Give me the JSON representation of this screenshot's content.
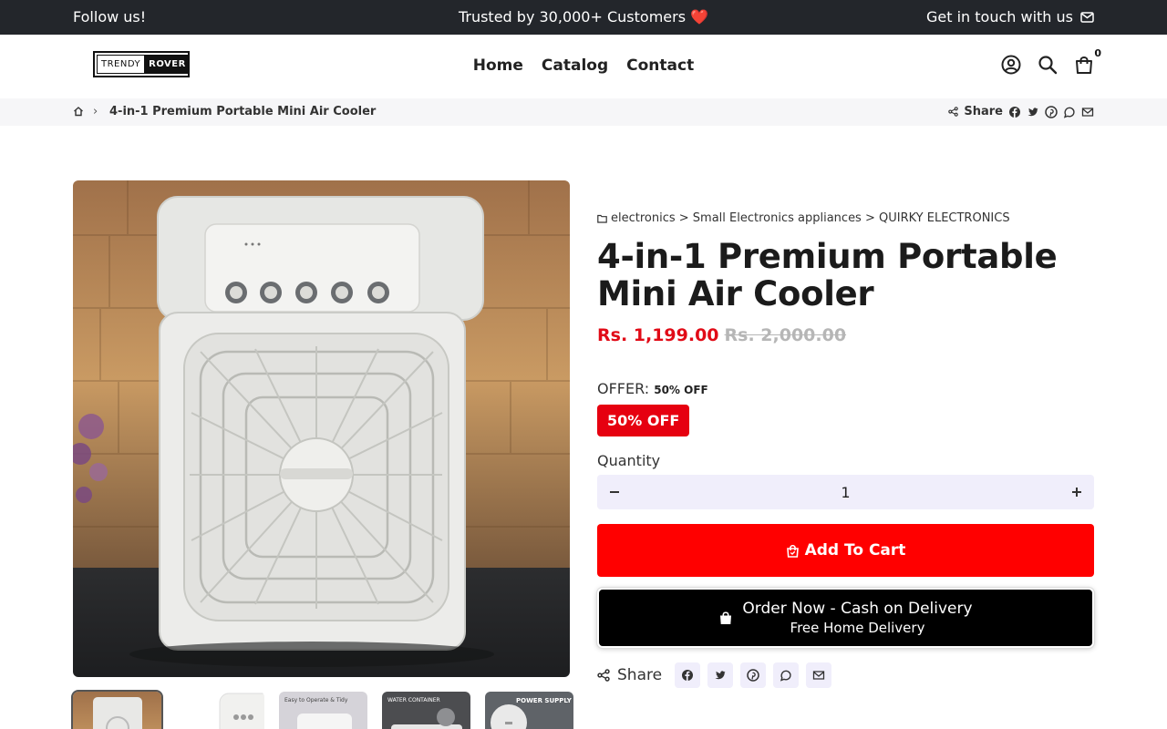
{
  "topbar": {
    "left": "Follow us!",
    "center": "Trusted by 30,000+ Customers",
    "center_emoji": "❤️",
    "right": "Get in touch with us"
  },
  "header": {
    "logo": {
      "part1": "TRENDY",
      "part2": "ROVER"
    },
    "nav": [
      "Home",
      "Catalog",
      "Contact"
    ],
    "cart_count": "0"
  },
  "breadcrumb": {
    "current": "4-in-1 Premium Portable Mini Air Cooler",
    "share_label": "Share"
  },
  "product": {
    "categories": "electronics > Small Electronics appliances > QUIRKY ELECTRONICS",
    "title": "4-in-1 Premium Portable Mini Air Cooler",
    "price": "Rs. 1,199.00",
    "compare_price": "Rs. 2,000.00",
    "offer_label": "OFFER:",
    "offer_value": "50% OFF",
    "offer_badge": "50% OFF",
    "quantity_label": "Quantity",
    "quantity": "1",
    "add_to_cart": "Add To Cart",
    "cod_line1": "Order Now - Cash on Delivery",
    "cod_line2": "Free Home Delivery",
    "share_label": "Share",
    "thumb_labels": [
      "",
      "",
      "Easy to Operate & Tidy",
      "WATER CONTAINER",
      "POWER SUPPLY"
    ]
  },
  "colors": {
    "topbar_bg": "#23262b",
    "price_red": "#e10b17",
    "add_to_cart_bg": "#ff0000",
    "cod_bg": "#000000",
    "qty_bg": "#f0eefb"
  }
}
